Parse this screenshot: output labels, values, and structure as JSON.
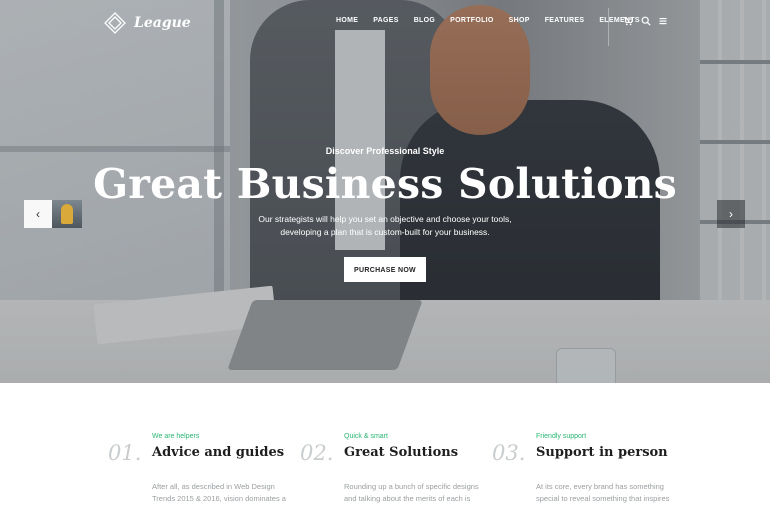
{
  "brand": {
    "name": "League"
  },
  "nav": {
    "items": [
      "HOME",
      "PAGES",
      "BLOG",
      "PORTFOLIO",
      "SHOP",
      "FEATURES",
      "ELEMENTS"
    ],
    "icons": [
      "cart-icon",
      "search-icon",
      "menu-icon"
    ]
  },
  "hero": {
    "eyebrow": "Discover Professional Style",
    "headline": "Great Business Solutions",
    "subtext_line1": "Our strategists will help you set an objective and choose your tools,",
    "subtext_line2": "developing a plan that is custom-built for your business.",
    "cta_label": "PURCHASE NOW",
    "prev_arrow": "‹",
    "next_arrow": "›"
  },
  "features": [
    {
      "number": "01.",
      "tag": "We are helpers",
      "title": "Advice and guides",
      "text": "After all, as described in Web Design Trends 2015 & 2016, vision dominates a"
    },
    {
      "number": "02.",
      "tag": "Quick & smart",
      "title": "Great Solutions",
      "text": "Rounding up a bunch of specific designs and talking about the merits of each is"
    },
    {
      "number": "03.",
      "tag": "Friendly support",
      "title": "Support in person",
      "text": "At its core, every brand has something special to reveal something that inspires"
    }
  ],
  "colors": {
    "accent": "#2bb673",
    "headline": "#ffffff",
    "cta_bg": "#ffffff"
  }
}
